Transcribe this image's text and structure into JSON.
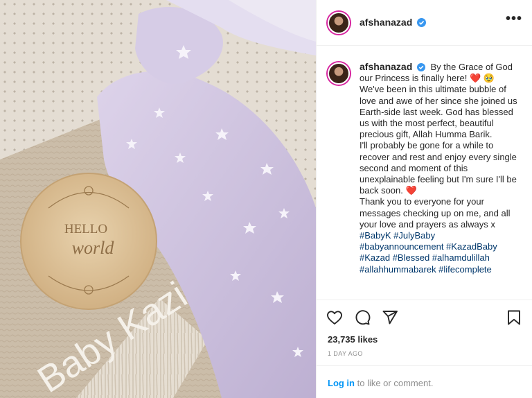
{
  "post": {
    "username": "afshanazad",
    "more_label": "•••",
    "caption": {
      "paragraph1": "By the Grace of God our Princess is finally here! ",
      "paragraph1_emoji": "❤️ 🥹",
      "paragraph2": "We've been in this ultimate bubble of love and awe of her since she joined us Earth-side last week. God has blessed us with the most perfect, beautiful precious gift, Allah Humma Barik.",
      "paragraph3": "I'll probably be gone for a while to recover and rest and enjoy every single second and moment of this unexplainable feeling but I'm sure I'll be back soon. ",
      "paragraph3_emoji": "❤️",
      "paragraph4": "Thank you to everyone for your messages checking up on me, and all your love and prayers as always x",
      "hashtags": "#BabyK #JulyBaby #babyannouncement #KazadBaby #Kazad #Blessed #alhamdulillah #allahhummabarek #lifecomplete"
    },
    "likes": "23,735 likes",
    "time": "1 DAY AGO"
  },
  "photo": {
    "disc_line1": "HELLO",
    "disc_line2": "world",
    "blanket_text": "Baby Kazi"
  },
  "footer": {
    "login_label": "Log in",
    "rest": " to like or comment."
  },
  "icons": [
    "verified-badge-icon",
    "heart-icon",
    "comment-icon",
    "share-icon",
    "bookmark-icon",
    "more-options-icon"
  ],
  "colors": {
    "text": "#262626",
    "muted": "#8e8e8e",
    "hashtag": "#00376b",
    "link": "#0095f6",
    "verified": "#3897f0",
    "heart": "#d81b3c",
    "onesie": "#cfc4e0",
    "wood": "#dcc098"
  }
}
